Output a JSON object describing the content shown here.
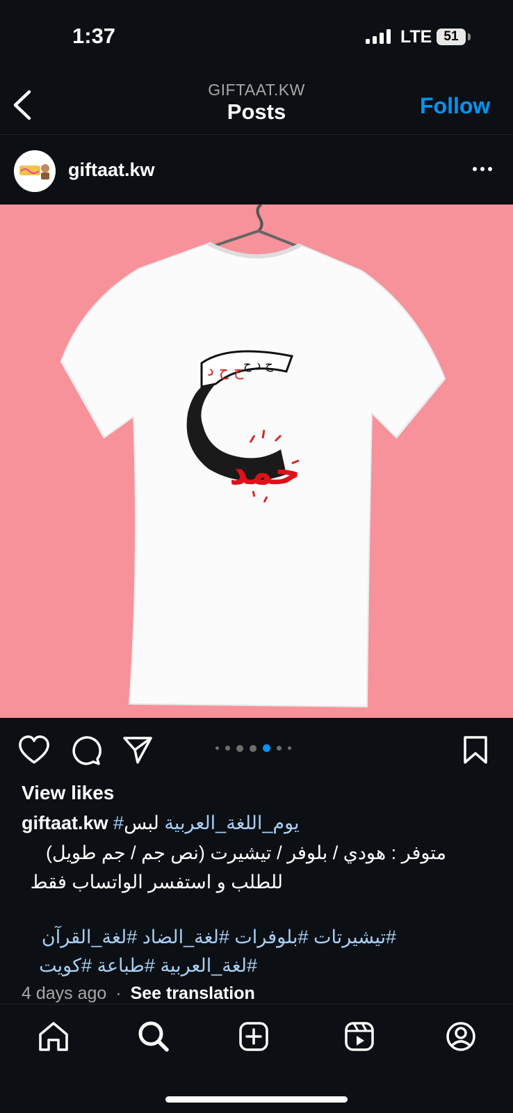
{
  "status_bar": {
    "time": "1:37",
    "network": "LTE",
    "battery": "51"
  },
  "header": {
    "account": "GIFTAAT.KW",
    "title": "Posts",
    "follow_label": "Follow"
  },
  "post": {
    "username": "giftaat.kw",
    "image_icon": "tshirt-photo",
    "carousel": {
      "count": 7,
      "active_index": 4
    },
    "view_likes": "View likes",
    "caption": {
      "username": "giftaat.kw",
      "hashtag": "#يوم_اللغة_العربية",
      "text": "لبس",
      "line2": "متوفر : هودي / بلوفر / تيشيرت (نص جم / جم طويل)",
      "line3": "للطلب و استفسر الواتساب فقط",
      "tags_line1": "#تيشيرتات #بلوفرات #لغة_الضاد #لغة_القرآن",
      "tags_line2": "#لغة_العربية #طباعة #كويت"
    },
    "time_ago": "4 days ago",
    "separator": "·",
    "see_translation": "See translation"
  },
  "colors": {
    "background": "#0c1014",
    "accent": "#0095f6",
    "hashtag": "#a7cff5",
    "image_bg": "#f7919a"
  },
  "bottom_nav": [
    "home-icon",
    "search-icon",
    "create-icon",
    "reels-icon",
    "profile-icon"
  ]
}
